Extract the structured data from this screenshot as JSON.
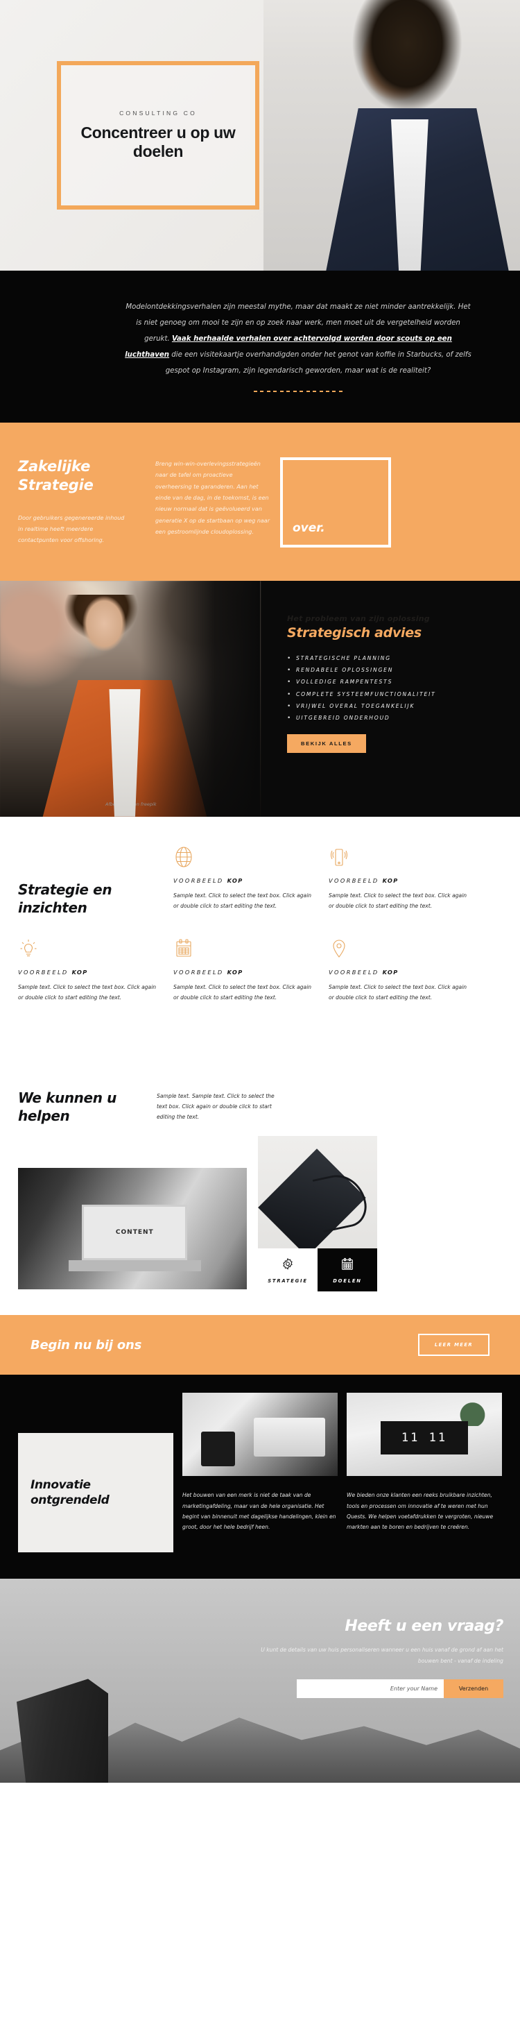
{
  "hero": {
    "eyebrow": "CONSULTING CO",
    "title": "Concentreer u op uw doelen"
  },
  "quote": {
    "part1": "Modelontdekkingsverhalen zijn meestal mythe, maar dat maakt ze niet minder aantrekkelijk. Het is niet genoeg om mooi te zijn en op zoek naar werk, men moet uit de vergetelheid worden gerukt. ",
    "bold": "Vaak herhaalde verhalen over achtervolgd worden door scouts op een luchthaven",
    "part2": " die een visitekaartje overhandigden onder het genot van koffie in Starbucks, of zelfs gespot op Instagram, zijn legendarisch geworden, maar wat is de realiteit?"
  },
  "strategy": {
    "heading": "Zakelijke Strategie",
    "sub": "Door gebruikers gegenereerde inhoud in realtime heeft meerdere contactpunten voor offshoring.",
    "body": "Breng win-win-overlevingsstrategieën naar de tafel om proactieve overheersing te garanderen. Aan het einde van de dag, in de toekomst, is een nieuw normaal dat is geëvolueerd van generatie X op de startbaan op weg naar een gestroomlijnde cloudoplossing.",
    "box_label": "over."
  },
  "advice": {
    "ghost": "Het probleem van zijn oplossing",
    "heading": "Strategisch advies",
    "items": [
      "STRATEGISCHE PLANNING",
      "RENDABELE OPLOSSINGEN",
      "VOLLEDIGE RAMPENTESTS",
      "COMPLETE SYSTEEMFUNCTIONALITEIT",
      "VRIJWEL OVERAL TOEGANKELIJK",
      "UITGEBREID ONDERHOUD"
    ],
    "button": "BEKIJK ALLES",
    "credit": "Afbeelding van freepik"
  },
  "features": {
    "heading": "Strategie en inzichten",
    "cells": [
      {
        "icon": "globe-icon",
        "kop_light": "VOORBEELD ",
        "kop_bold": "KOP",
        "text": "Sample text. Click to select the text box. Click again or double click to start editing the text."
      },
      {
        "icon": "mobile-icon",
        "kop_light": "VOORBEELD ",
        "kop_bold": "KOP",
        "text": "Sample text. Click to select the text box. Click again or double click to start editing the text."
      },
      {
        "icon": "bulb-icon",
        "kop_light": "VOORBEELD ",
        "kop_bold": "KOP",
        "text": "Sample text. Click to select the text box. Click again or double click to start editing the text."
      },
      {
        "icon": "calendar-icon",
        "kop_light": "VOORBEELD ",
        "kop_bold": "KOP",
        "text": "Sample text. Click to select the text box. Click again or double click to start editing the text."
      },
      {
        "icon": "pin-icon",
        "kop_light": "VOORBEELD ",
        "kop_bold": "KOP",
        "text": "Sample text. Click to select the text box. Click again or double click to start editing the text."
      }
    ]
  },
  "help": {
    "heading": "We kunnen u helpen",
    "text": "Sample text. Sample text. Click to select the text box. Click again or double click to start editing the text.",
    "laptop_label": "CONTENT",
    "tiles": [
      {
        "icon": "gear-icon",
        "label": "STRATEGIE"
      },
      {
        "icon": "calendar-icon",
        "label": "DOELEN"
      }
    ]
  },
  "cta": {
    "heading": "Begin nu bij ons",
    "button": "LEER MEER"
  },
  "innovation": {
    "heading": "Innovatie ontgrendeld",
    "col2_text": "Het bouwen van een merk is niet de taak van de marketingafdeling, maar van de hele organisatie. Het begint van binnenuit met dagelijkse handelingen, klein en groot, door het hele bedrijf heen.",
    "col3_text": "We bieden onze klanten een reeks bruikbare inzichten, tools en processen om innovatie af te weren met hun Quests. We helpen voetafdrukken te vergroten, nieuwe markten aan te boren en bedrijven te creëren.",
    "clock_number": "11 11"
  },
  "question": {
    "heading": "Heeft u een vraag?",
    "text": "U kunt de details van uw huis personaliseren wanneer u een huis vanaf de grond af aan het bouwen bent - vanaf de indeling",
    "input_placeholder": "Enter your Name",
    "submit": "Verzenden"
  },
  "colors": {
    "accent": "#f5a961",
    "dark": "#060606",
    "light": "#efeeec"
  }
}
